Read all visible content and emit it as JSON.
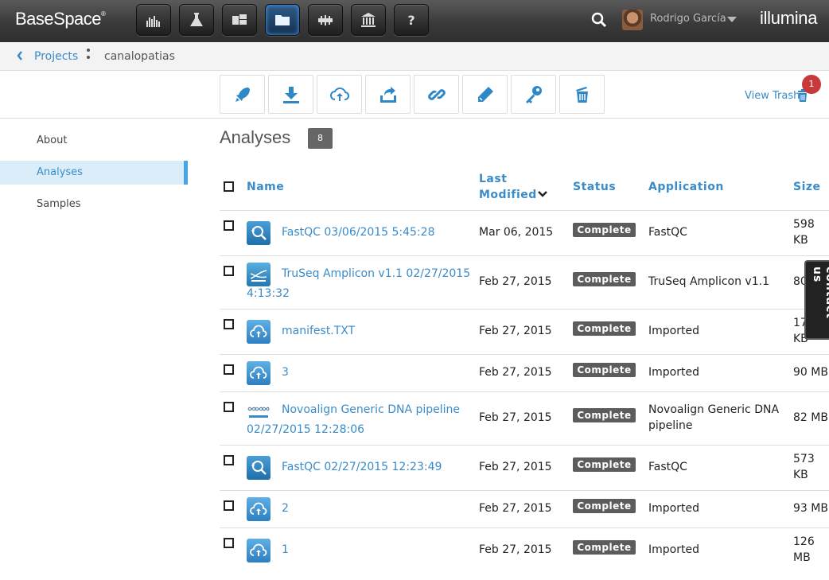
{
  "header": {
    "logo_text": "BaseSpace",
    "logo_mark": "®",
    "nav_icons": [
      "dashboard-icon",
      "labs-icon",
      "apps-icon",
      "projects-icon",
      "runs-icon",
      "public-data-icon",
      "help-icon"
    ],
    "active_nav": "projects-icon",
    "user_name": "Rodrigo García",
    "brand": "illumina"
  },
  "breadcrumb": {
    "projects_label": "Projects",
    "current": "canalopatias"
  },
  "toolbar": {
    "tools": [
      "launch-app-icon",
      "download-icon",
      "upload-icon",
      "share-icon",
      "link-icon",
      "edit-icon",
      "key-icon",
      "delete-icon"
    ],
    "view_trash_label": "View Trash",
    "trash_count": "1"
  },
  "sidebar": {
    "items": [
      {
        "label": "About"
      },
      {
        "label": "Analyses"
      },
      {
        "label": "Samples"
      }
    ],
    "active": "Analyses"
  },
  "main": {
    "title": "Analyses",
    "count": "8",
    "columns": {
      "name": "Name",
      "last_modified": "Last Modified",
      "status": "Status",
      "application": "Application",
      "size": "Size"
    },
    "rows": [
      {
        "icon": "fastqc",
        "name_line1": "FastQC 03/06/2015 5:45:28",
        "name_line2": "",
        "modified": "Mar 06, 2015",
        "status": "Complete",
        "app_line1": "FastQC",
        "app_line2": "",
        "size_line1": "598",
        "size_line2": "KB"
      },
      {
        "icon": "truseq",
        "name_line1": "TruSeq Amplicon v1.1 02/27/2015",
        "name_line2": "4:13:32",
        "modified": "Feb 27, 2015",
        "status": "Complete",
        "app_line1": "TruSeq Amplicon v1.1",
        "app_line2": "",
        "size_line1": "80",
        "size_line2": ""
      },
      {
        "icon": "upload",
        "name_line1": "manifest.TXT",
        "name_line2": "",
        "modified": "Feb 27, 2015",
        "status": "Complete",
        "app_line1": "Imported",
        "app_line2": "",
        "size_line1": "17",
        "size_line2": "KB"
      },
      {
        "icon": "upload",
        "name_line1": "3",
        "name_line2": "",
        "modified": "Feb 27, 2015",
        "status": "Complete",
        "app_line1": "Imported",
        "app_line2": "",
        "size_line1": "90 MB",
        "size_line2": ""
      },
      {
        "icon": "novo",
        "name_line1": "Novoalign Generic DNA pipeline",
        "name_line2": "02/27/2015 12:28:06",
        "modified": "Feb 27, 2015",
        "status": "Complete",
        "app_line1": "Novoalign Generic DNA",
        "app_line2": "pipeline",
        "size_line1": "82 MB",
        "size_line2": ""
      },
      {
        "icon": "fastqc",
        "name_line1": "FastQC 02/27/2015 12:23:49",
        "name_line2": "",
        "modified": "Feb 27, 2015",
        "status": "Complete",
        "app_line1": "FastQC",
        "app_line2": "",
        "size_line1": "573",
        "size_line2": "KB"
      },
      {
        "icon": "upload",
        "name_line1": "2",
        "name_line2": "",
        "modified": "Feb 27, 2015",
        "status": "Complete",
        "app_line1": "Imported",
        "app_line2": "",
        "size_line1": "93 MB",
        "size_line2": ""
      },
      {
        "icon": "upload",
        "name_line1": "1",
        "name_line2": "",
        "modified": "Feb 27, 2015",
        "status": "Complete",
        "app_line1": "Imported",
        "app_line2": "",
        "size_line1": "126",
        "size_line2": "MB"
      }
    ]
  },
  "contact_tab": "contact us",
  "colors": {
    "link": "#3a8bc9",
    "badge": "#c9393b",
    "status_bg": "#5c5c5c",
    "active_side": "#dcedfa"
  }
}
